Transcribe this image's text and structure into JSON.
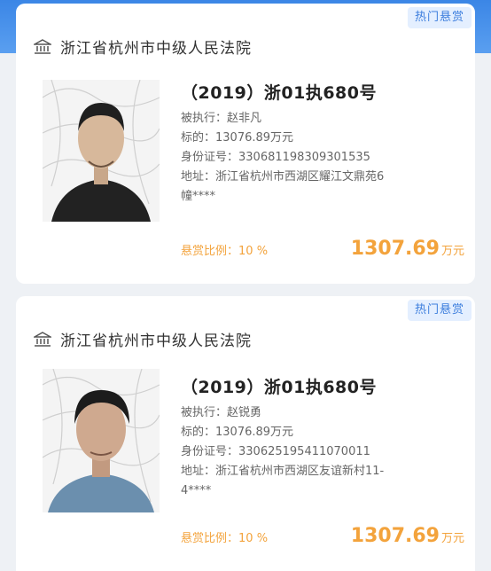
{
  "cards": [
    {
      "badge": "热门悬赏",
      "court": "浙江省杭州市中级人民法院",
      "case_no": "（2019）浙01执680号",
      "executee_label": "被执行：",
      "executee": "赵非凡",
      "target_label": "标的：",
      "target": "13076.89万元",
      "id_label": "身份证号：",
      "id_no": "330681198309301535",
      "address_label": "地址：",
      "address_l1": "浙江省杭州市西湖区耀江文鼎苑6",
      "address_l2": "幢****",
      "ratio_label": "悬赏比例：",
      "ratio": "10 %",
      "amount": "1307.69",
      "amount_unit": "万元"
    },
    {
      "badge": "热门悬赏",
      "court": "浙江省杭州市中级人民法院",
      "case_no": "（2019）浙01执680号",
      "executee_label": "被执行：",
      "executee": "赵锐勇",
      "target_label": "标的：",
      "target": "13076.89万元",
      "id_label": "身份证号：",
      "id_no": "330625195411070011",
      "address_label": "地址：",
      "address_l1": "浙江省杭州市西湖区友谊新村11-",
      "address_l2": "4****",
      "ratio_label": "悬赏比例：",
      "ratio": "10 %",
      "amount": "1307.69",
      "amount_unit": "万元"
    }
  ],
  "colors": {
    "accent_orange": "#f3a33c",
    "badge_blue": "#3b7ddd",
    "header_blue": "#3b86e6"
  }
}
